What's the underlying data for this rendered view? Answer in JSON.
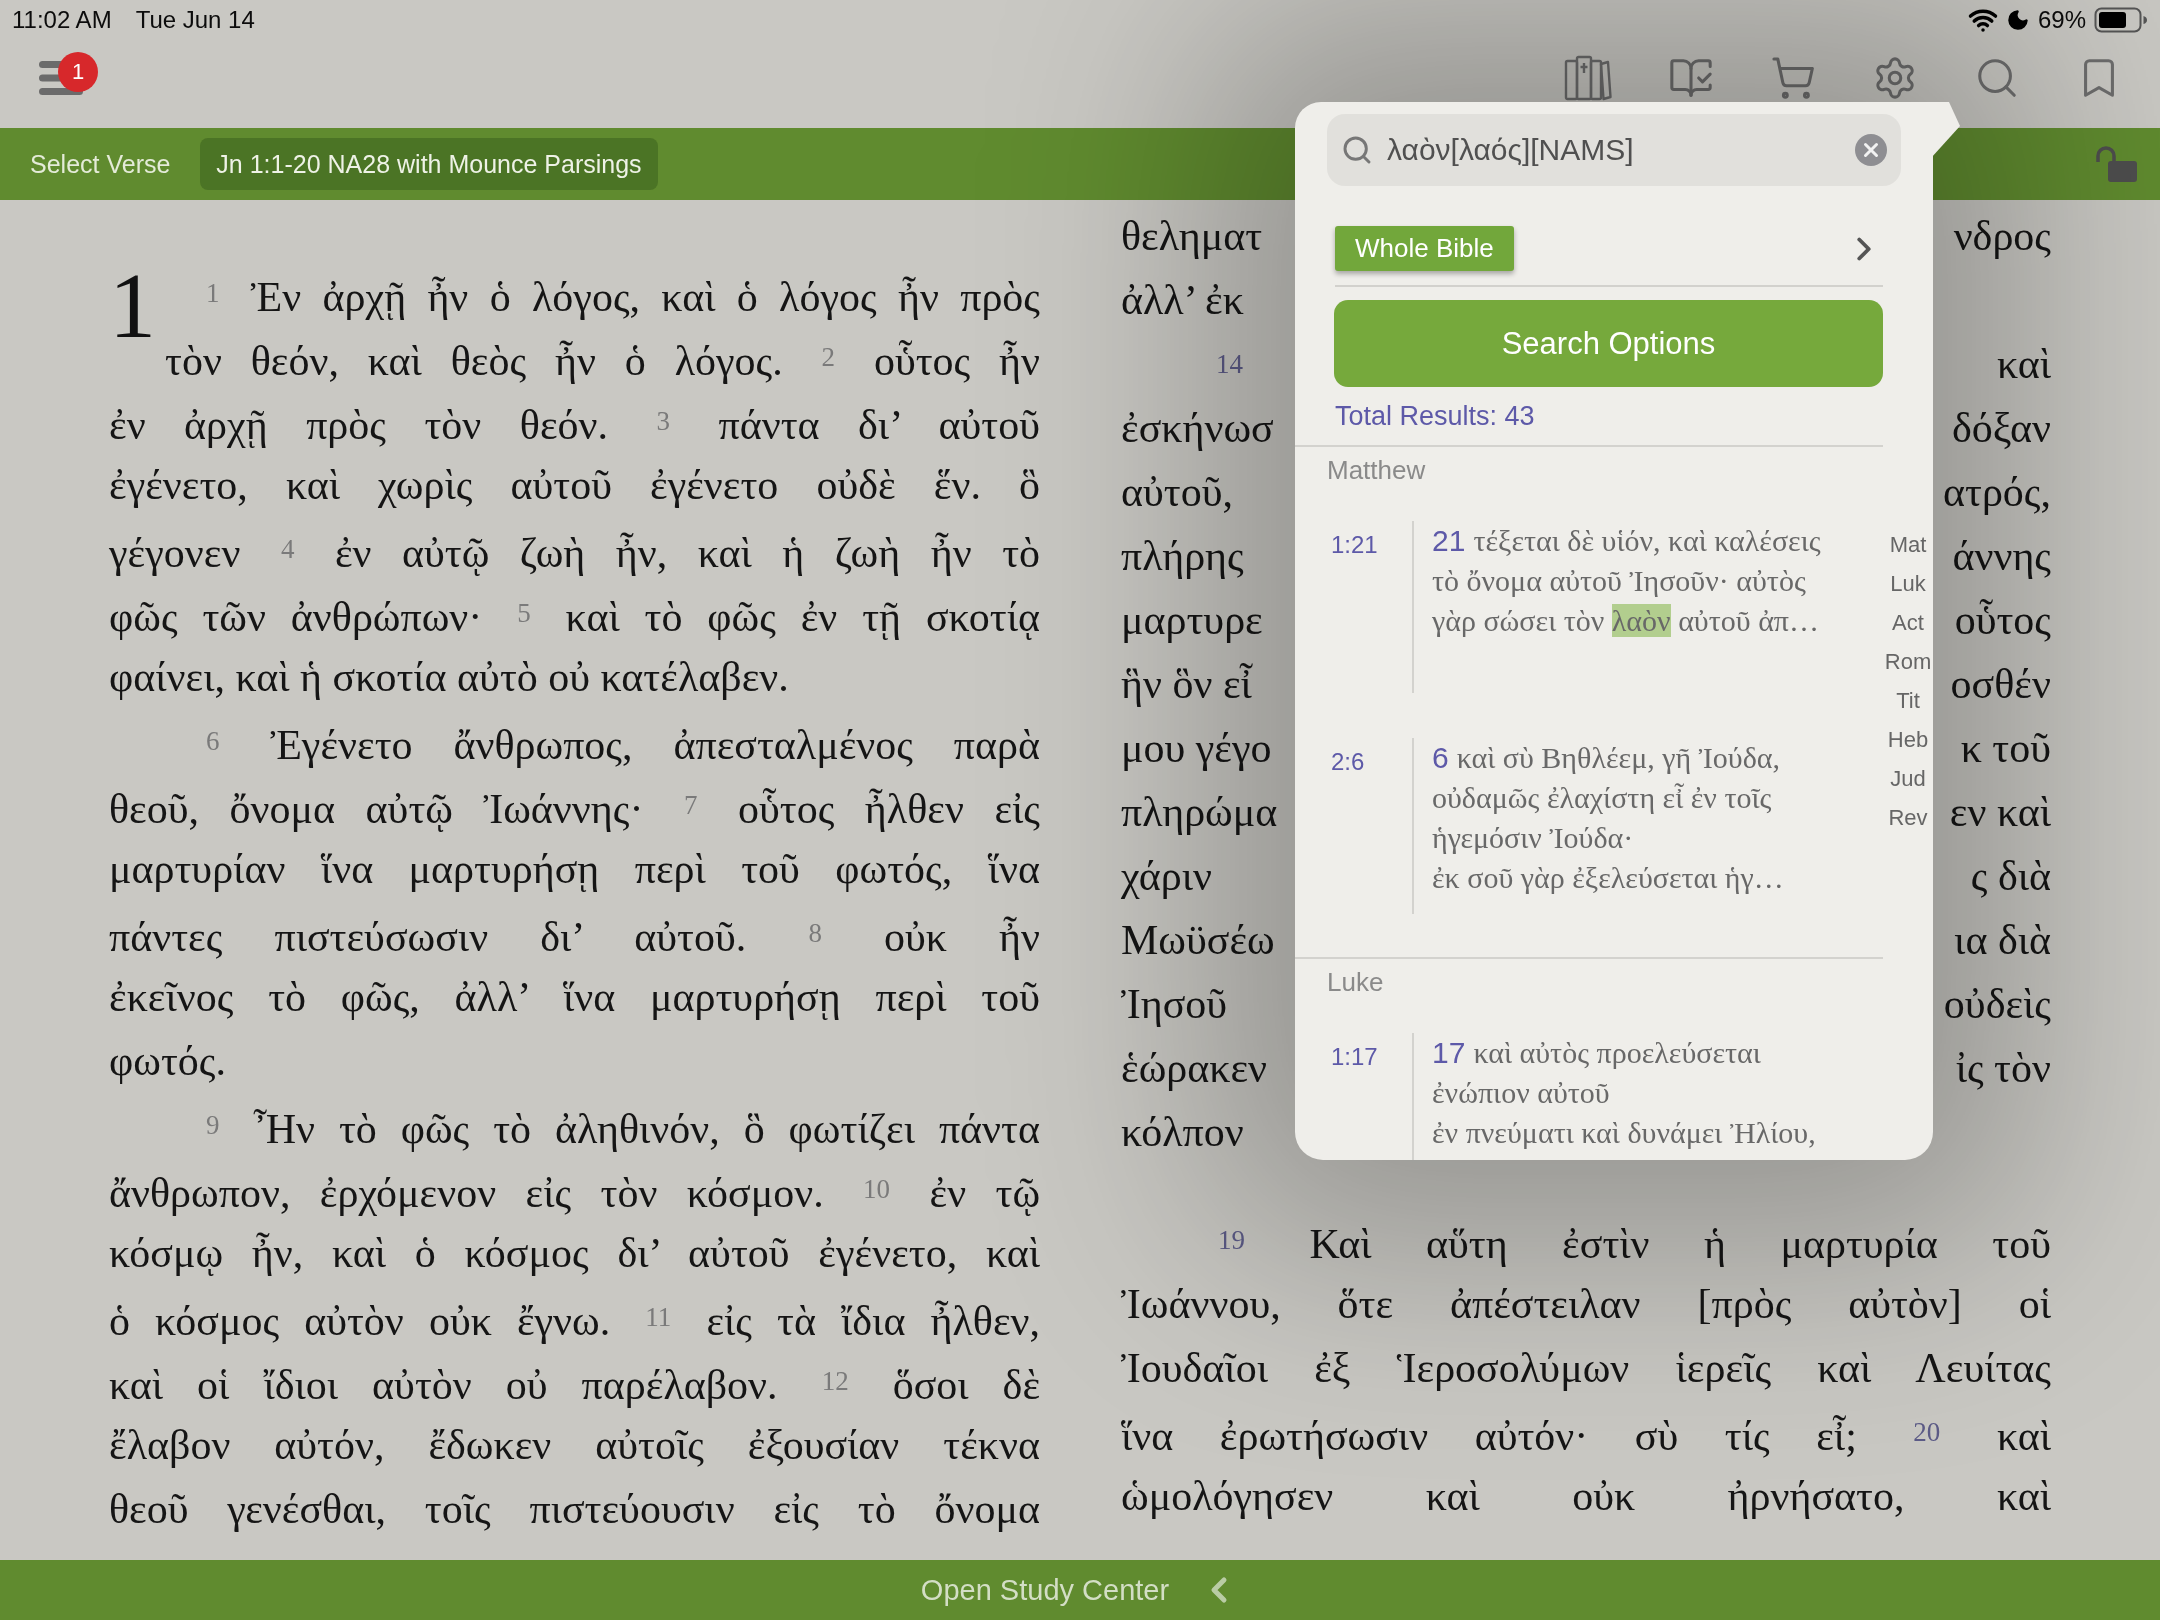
{
  "status_bar": {
    "time": "11:02 AM",
    "date": "Tue Jun 14",
    "battery": "69%"
  },
  "toolbar": {
    "menu_badge": "1"
  },
  "verse_bar": {
    "label": "Select Verse",
    "passage": "Jn 1:1-20 NA28 with Mounce Parsings"
  },
  "left_column": {
    "chapter": "1",
    "opening_lines": [
      {
        "kind": "start",
        "segments": [
          {
            "kind": "verse",
            "text": "1"
          },
          {
            "kind": "text",
            "text": "Ἐν ἀρχῇ ἦν ὁ λόγος, καὶ ὁ λόγος ἦν πρὸς"
          }
        ]
      },
      {
        "kind": "body",
        "segments": [
          {
            "kind": "text",
            "text": "τὸν θεόν, καὶ θεὸς ἦν ὁ λόγος."
          },
          {
            "kind": "verse",
            "text": "2"
          },
          {
            "kind": "text",
            "text": "οὗτος ἦν"
          }
        ]
      }
    ],
    "lines": [
      {
        "kind": "body",
        "segments": [
          {
            "kind": "text",
            "text": "ἐν ἀρχῇ πρὸς τὸν θεόν."
          },
          {
            "kind": "verse",
            "text": "3"
          },
          {
            "kind": "text",
            "text": "πάντα δι’ αὐτοῦ"
          }
        ]
      },
      {
        "kind": "body",
        "segments": [
          {
            "kind": "text",
            "text": "ἐγένετο, καὶ χωρὶς αὐτοῦ ἐγένετο οὐδὲ ἕν. ὃ"
          }
        ]
      },
      {
        "kind": "body",
        "segments": [
          {
            "kind": "text",
            "text": "γέγονεν"
          },
          {
            "kind": "verse",
            "text": "4"
          },
          {
            "kind": "text",
            "text": "ἐν αὐτῷ ζωὴ ἦν, καὶ ἡ ζωὴ ἦν τὸ"
          }
        ]
      },
      {
        "kind": "body",
        "segments": [
          {
            "kind": "text",
            "text": "φῶς τῶν ἀνθρώπων·"
          },
          {
            "kind": "verse",
            "text": "5"
          },
          {
            "kind": "text",
            "text": "καὶ τὸ φῶς ἐν τῇ σκοτίᾳ"
          }
        ]
      },
      {
        "kind": "end",
        "segments": [
          {
            "kind": "text",
            "text": "φαίνει, καὶ ἡ σκοτία αὐτὸ οὐ κατέλαβεν."
          }
        ]
      },
      {
        "kind": "start",
        "segments": [
          {
            "kind": "verse",
            "text": "6"
          },
          {
            "kind": "text",
            "text": "Ἐγένετο ἄνθρωπος, ἀπεσταλμένος παρὰ"
          }
        ]
      },
      {
        "kind": "body",
        "segments": [
          {
            "kind": "text",
            "text": "θεοῦ, ὄνομα αὐτῷ Ἰωάννης·"
          },
          {
            "kind": "verse",
            "text": "7"
          },
          {
            "kind": "text",
            "text": "οὗτος ἦλθεν εἰς"
          }
        ]
      },
      {
        "kind": "body",
        "segments": [
          {
            "kind": "text",
            "text": "μαρτυρίαν ἵνα μαρτυρήσῃ περὶ τοῦ φωτός, ἵνα"
          }
        ]
      },
      {
        "kind": "body",
        "segments": [
          {
            "kind": "text",
            "text": "πάντες πιστεύσωσιν δι’ αὐτοῦ."
          },
          {
            "kind": "verse",
            "text": "8"
          },
          {
            "kind": "text",
            "text": "οὐκ ἦν"
          }
        ]
      },
      {
        "kind": "body",
        "segments": [
          {
            "kind": "text",
            "text": "ἐκεῖνος τὸ φῶς, ἀλλ’ ἵνα μαρτυρήσῃ περὶ τοῦ"
          }
        ]
      },
      {
        "kind": "end",
        "segments": [
          {
            "kind": "text",
            "text": "φωτός."
          }
        ]
      },
      {
        "kind": "start",
        "segments": [
          {
            "kind": "verse",
            "text": "9"
          },
          {
            "kind": "text",
            "text": "Ἦν τὸ φῶς τὸ ἀληθινόν, ὃ φωτίζει πάντα"
          }
        ]
      },
      {
        "kind": "body",
        "segments": [
          {
            "kind": "text",
            "text": "ἄνθρωπον, ἐρχόμενον εἰς τὸν κόσμον."
          },
          {
            "kind": "verse",
            "text": "10"
          },
          {
            "kind": "text",
            "text": "ἐν τῷ"
          }
        ]
      },
      {
        "kind": "body",
        "segments": [
          {
            "kind": "text",
            "text": "κόσμῳ ἦν, καὶ ὁ κόσμος δι’ αὐτοῦ ἐγένετο, καὶ"
          }
        ]
      },
      {
        "kind": "body",
        "segments": [
          {
            "kind": "text",
            "text": "ὁ κόσμος αὐτὸν οὐκ ἔγνω."
          },
          {
            "kind": "verse",
            "text": "11"
          },
          {
            "kind": "text",
            "text": "εἰς τὰ ἴδια ἦλθεν,"
          }
        ]
      },
      {
        "kind": "body",
        "segments": [
          {
            "kind": "text",
            "text": "καὶ οἱ ἴδιοι αὐτὸν οὐ παρέλαβον."
          },
          {
            "kind": "verse",
            "text": "12"
          },
          {
            "kind": "text",
            "text": "ὅσοι δὲ"
          }
        ]
      },
      {
        "kind": "body",
        "segments": [
          {
            "kind": "text",
            "text": "ἔλαβον αὐτόν, ἔδωκεν αὐτοῖς ἐξουσίαν τέκνα"
          }
        ]
      },
      {
        "kind": "body",
        "segments": [
          {
            "kind": "text",
            "text": "θεοῦ γενέσθαι, τοῖς πιστεύουσιν εἰς τὸ ὄνομα"
          }
        ]
      }
    ]
  },
  "right_column": {
    "covered_lines": [
      {
        "left": "θεληματ",
        "right": "νδρος"
      },
      {
        "left": "ἀλλ’ ἐκ"
      },
      {
        "verse": "14",
        "right": "καὶ"
      },
      {
        "left": "ἐσκήνωσ",
        "right": "δόξαν"
      },
      {
        "left": "αὐτοῦ,",
        "right": "ατρός,"
      },
      {
        "left": "πλήρης",
        "right": "άννης"
      },
      {
        "left": "μαρτυρε",
        "right": "οὗτος"
      },
      {
        "left": "ἣν ὃν εἶ",
        "right": "οσθέν"
      },
      {
        "left": "μου γέγο",
        "right": "κ τοῦ"
      },
      {
        "left": "πληρώμα",
        "right": "εν καὶ"
      },
      {
        "left": "χάριν",
        "right": "ς διὰ"
      },
      {
        "left": "Μωϋσέω",
        "right": "ια διὰ"
      },
      {
        "left": "Ἰησοῦ",
        "right": "οὐδεὶς"
      },
      {
        "left": "ἑώρακεν",
        "right": "ἰς τὸν"
      },
      {
        "left": "κόλπον"
      }
    ],
    "lines": [
      {
        "kind": "start",
        "segments": [
          {
            "kind": "verse",
            "text": "19"
          },
          {
            "kind": "text",
            "text": "Καὶ αὕτη ἐστὶν ἡ μαρτυρία τοῦ"
          }
        ]
      },
      {
        "kind": "body",
        "segments": [
          {
            "kind": "text",
            "text": "Ἰωάννου, ὅτε ἀπέστειλαν [πρὸς αὐτὸν] οἱ"
          }
        ]
      },
      {
        "kind": "body",
        "segments": [
          {
            "kind": "text",
            "text": "Ἰουδαῖοι ἐξ Ἱεροσολύμων ἱερεῖς καὶ Λευίτας"
          }
        ]
      },
      {
        "kind": "body",
        "segments": [
          {
            "kind": "text",
            "text": "ἵνα ἐρωτήσωσιν αὐτόν· σὺ τίς εἶ;"
          },
          {
            "kind": "verse",
            "text": "20"
          },
          {
            "kind": "text",
            "text": "καὶ"
          }
        ]
      },
      {
        "kind": "body",
        "segments": [
          {
            "kind": "text",
            "text": "ὡμολόγησεν καὶ οὐκ ἠρνήσατο, καὶ"
          }
        ]
      }
    ]
  },
  "search_popover": {
    "query": "λαὸν[λαός][NAMS]",
    "scope": "Whole Bible",
    "options_button": "Search Options",
    "total": "Total Results: 43",
    "groups": [
      {
        "book": "Matthew",
        "results": [
          {
            "reference": "1:21",
            "verse": "21",
            "lines": [
              [
                {
                  "text": "τέξεται δὲ υἱόν, καὶ καλέσεις",
                  "highlighted": false
                }
              ],
              [
                {
                  "text": "τὸ ὄνομα αὐτοῦ Ἰησοῦν· αὐτὸς",
                  "highlighted": false
                }
              ],
              [
                {
                  "text": "γὰρ σώσει τὸν",
                  "highlighted": false
                },
                {
                  "text": "λαὸν",
                  "highlighted": true
                },
                {
                  "text": "αὐτοῦ ἀπ…",
                  "highlighted": false
                }
              ]
            ]
          },
          {
            "reference": "2:6",
            "verse": "6",
            "lines": [
              [
                {
                  "text": "καὶ σὺ Βηθλέεμ, γῆ Ἰούδα,",
                  "highlighted": false
                }
              ],
              [
                {
                  "text": "οὐδαμῶς ἐλαχίστη εἶ ἐν τοῖς",
                  "highlighted": false
                }
              ],
              [
                {
                  "text": "ἡγεμόσιν Ἰούδα·",
                  "highlighted": false
                }
              ],
              [
                {
                  "text": "ἐκ σοῦ γὰρ ἐξελεύσεται ἡγ…",
                  "highlighted": false
                }
              ]
            ]
          }
        ]
      },
      {
        "book": "Luke",
        "results": [
          {
            "reference": "1:17",
            "verse": "17",
            "lines": [
              [
                {
                  "text": "καὶ αὐτὸς προελεύσεται",
                  "highlighted": false
                }
              ],
              [
                {
                  "text": "ἐνώπιον αὐτοῦ",
                  "highlighted": false
                }
              ],
              [
                {
                  "text": "ἐν πνεύματι καὶ δυνάμει Ἠλίου,",
                  "highlighted": false
                }
              ]
            ]
          }
        ]
      }
    ],
    "book_index": [
      "Mat",
      "Luk",
      "Act",
      "Rom",
      "Tit",
      "Heb",
      "Jud",
      "Rev"
    ]
  },
  "bottom_bar": {
    "label": "Open Study Center"
  }
}
